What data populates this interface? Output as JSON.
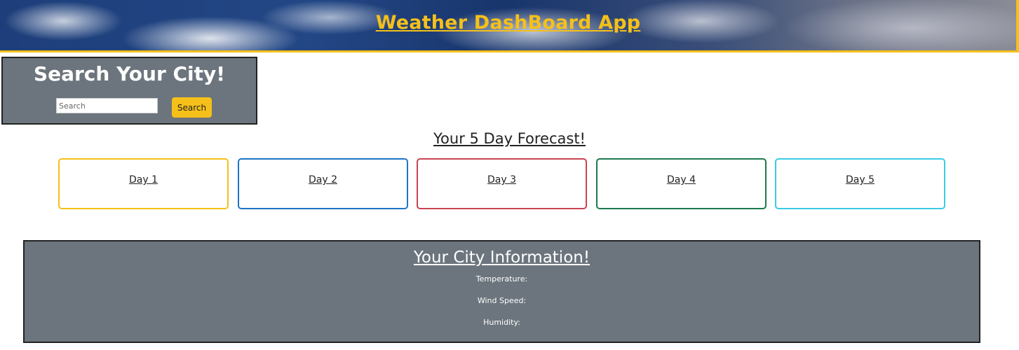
{
  "header": {
    "title": "Weather DashBoard App",
    "accent_color": "#f5c01a"
  },
  "search": {
    "heading": "Search Your City!",
    "placeholder": "Search",
    "value": "",
    "button_label": "Search",
    "button_color": "#f5c01a",
    "panel_color": "#6c757d"
  },
  "forecast": {
    "heading": "Your 5 Day Forecast!",
    "days": [
      {
        "label": "Day 1",
        "border_color": "#f5c01a"
      },
      {
        "label": "Day 2",
        "border_color": "#1f74c6"
      },
      {
        "label": "Day 3",
        "border_color": "#c94452"
      },
      {
        "label": "Day 4",
        "border_color": "#1b7a4f"
      },
      {
        "label": "Day 5",
        "border_color": "#3ccbe6"
      }
    ]
  },
  "city_info": {
    "heading": "Your City Information!",
    "temperature_label": "Temperature:",
    "wind_label": "Wind Speed:",
    "humidity_label": "Humidity:"
  }
}
